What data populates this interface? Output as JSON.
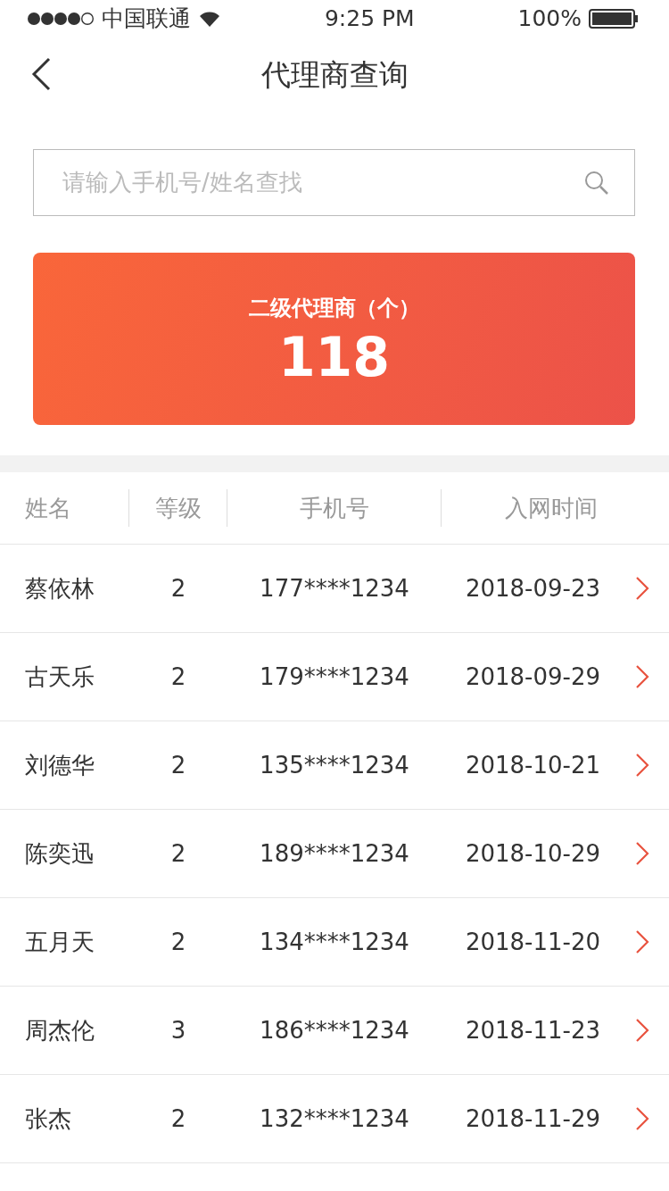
{
  "status_bar": {
    "carrier": "中国联通",
    "time": "9:25 PM",
    "battery": "100%"
  },
  "nav": {
    "title": "代理商查询"
  },
  "search": {
    "placeholder": "请输入手机号/姓名查找"
  },
  "summary": {
    "label": "二级代理商（个）",
    "count": "118"
  },
  "table": {
    "columns": [
      "姓名",
      "等级",
      "手机号",
      "入网时间"
    ],
    "rows": [
      {
        "name": "蔡依林",
        "level": "2",
        "phone": "177****1234",
        "date": "2018-09-23"
      },
      {
        "name": "古天乐",
        "level": "2",
        "phone": "179****1234",
        "date": "2018-09-29"
      },
      {
        "name": "刘德华",
        "level": "2",
        "phone": "135****1234",
        "date": "2018-10-21"
      },
      {
        "name": "陈奕迅",
        "level": "2",
        "phone": "189****1234",
        "date": "2018-10-29"
      },
      {
        "name": "五月天",
        "level": "2",
        "phone": "134****1234",
        "date": "2018-11-20"
      },
      {
        "name": "周杰伦",
        "level": "3",
        "phone": "186****1234",
        "date": "2018-11-23"
      },
      {
        "name": "张杰",
        "level": "2",
        "phone": "132****1234",
        "date": "2018-11-29"
      }
    ]
  }
}
